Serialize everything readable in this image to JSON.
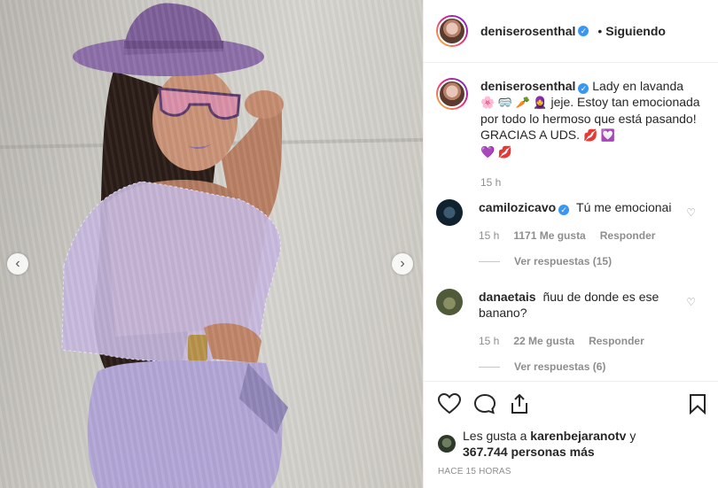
{
  "post": {
    "author": "deniserosenthal",
    "follow_dot": "•",
    "follow_label": "Siguiendo",
    "caption_author": "deniserosenthal",
    "caption_line1": "Lady en lavanda",
    "caption_emojis1": "🌸 🥽 🥕 🧕",
    "caption_rest": "jeje. Estoy tan emocionada por todo lo hermoso que está pasando! GRACIAS A UDS.",
    "caption_emojis2": "💋 💟",
    "caption_emojis3": "💜 💋",
    "caption_time": "15 h"
  },
  "comments": [
    {
      "user": "camilozicavo",
      "verified": true,
      "text": "Tú me emocionai",
      "time": "15 h",
      "likes": "1171 Me gusta",
      "reply": "Responder",
      "view_replies": "Ver respuestas (15)"
    },
    {
      "user": "danaetais",
      "verified": false,
      "text": "ñuu de donde es ese banano?",
      "time": "15 h",
      "likes": "22 Me gusta",
      "reply": "Responder",
      "view_replies": "Ver respuestas (6)"
    }
  ],
  "likes": {
    "prefix": "Les gusta a",
    "user": "karenbejaranotv",
    "conj": "y",
    "count": "367.744 personas más"
  },
  "timestamp": "HACE 15 HORAS",
  "nav": {
    "prev": "‹",
    "next": "›"
  },
  "colors": {
    "verified": "#3897f0",
    "muted": "#8e8e8e",
    "text": "#262626",
    "lavender": "#b9a9d6"
  },
  "icons": [
    "heart-icon",
    "comment-icon",
    "share-icon",
    "bookmark-icon",
    "verified-icon",
    "chevron-left-icon",
    "chevron-right-icon"
  ]
}
